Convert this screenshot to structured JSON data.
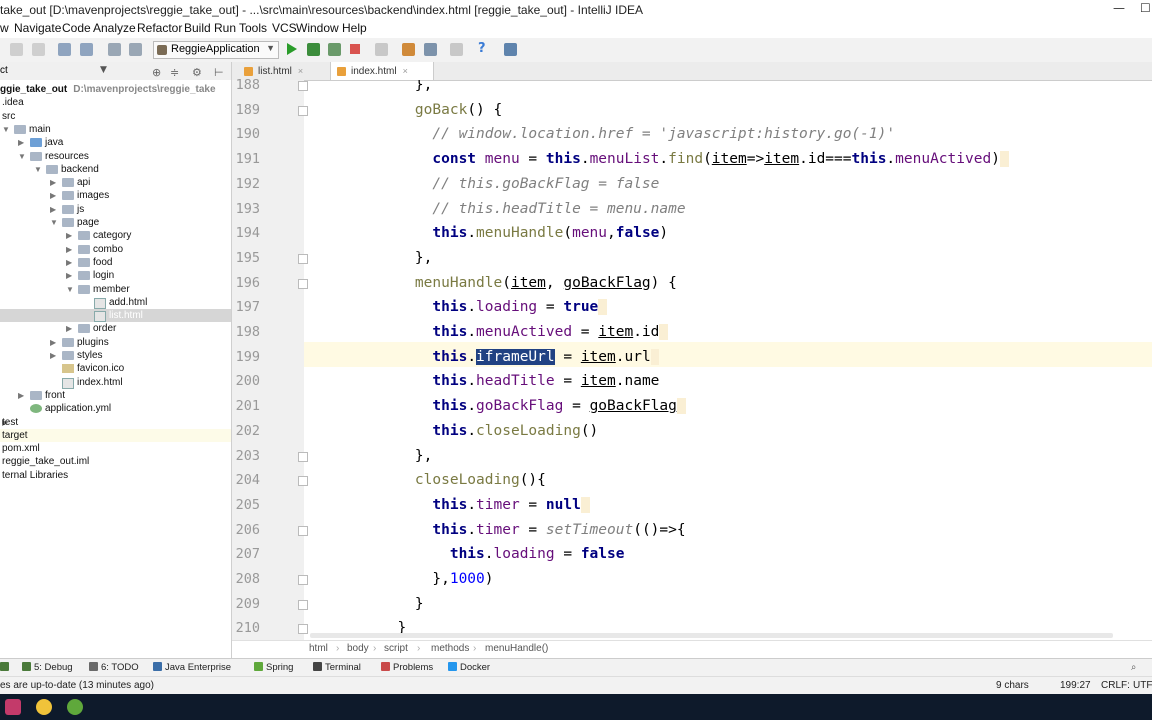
{
  "window": {
    "title": "take_out [D:\\mavenprojects\\reggie_take_out] - ...\\src\\main\\resources\\backend\\index.html [reggie_take_out] - IntelliJ IDEA",
    "minimize_glyph": "—",
    "maximize_glyph": "☐"
  },
  "menu": [
    "w",
    "Navigate",
    "Code",
    "Analyze",
    "Refactor",
    "Build",
    "Run",
    "Tools",
    "VCS",
    "Window",
    "Help"
  ],
  "toolbar": {
    "run_config": "ReggieApplication",
    "help_glyph": "?"
  },
  "project": {
    "header": "ct",
    "tree": [
      {
        "label": "ggie_take_out",
        "path": "D:\\mavenprojects\\reggie_take",
        "bold": true,
        "icon": "none"
      },
      {
        "label": ".idea",
        "icon": "none"
      },
      {
        "label": "src",
        "icon": "none"
      },
      {
        "label": "main",
        "icon": "folder"
      },
      {
        "label": "java",
        "icon": "srcf"
      },
      {
        "label": "resources",
        "icon": "folder"
      },
      {
        "label": "backend",
        "icon": "folder"
      },
      {
        "label": "api",
        "icon": "folder"
      },
      {
        "label": "images",
        "icon": "folder"
      },
      {
        "label": "js",
        "icon": "folder"
      },
      {
        "label": "page",
        "icon": "folder"
      },
      {
        "label": "category",
        "icon": "folder"
      },
      {
        "label": "combo",
        "icon": "folder"
      },
      {
        "label": "food",
        "icon": "folder"
      },
      {
        "label": "login",
        "icon": "folder"
      },
      {
        "label": "member",
        "icon": "folder"
      },
      {
        "label": "add.html",
        "icon": "html"
      },
      {
        "label": "list.html",
        "icon": "html",
        "selected": true
      },
      {
        "label": "order",
        "icon": "folder"
      },
      {
        "label": "plugins",
        "icon": "folder"
      },
      {
        "label": "styles",
        "icon": "folder"
      },
      {
        "label": "favicon.ico",
        "icon": "ico"
      },
      {
        "label": "index.html",
        "icon": "html"
      },
      {
        "label": "front",
        "icon": "folder"
      },
      {
        "label": "application.yml",
        "icon": "yml"
      },
      {
        "label": "test",
        "icon": "none"
      },
      {
        "label": "target",
        "icon": "none",
        "highlight": true
      },
      {
        "label": "pom.xml",
        "icon": "none"
      },
      {
        "label": "reggie_take_out.iml",
        "icon": "none"
      },
      {
        "label": "ternal Libraries",
        "icon": "none"
      }
    ]
  },
  "tabs": [
    {
      "label": "list.html",
      "close": "×"
    },
    {
      "label": "index.html",
      "close": "×",
      "active": true
    }
  ],
  "code": {
    "lines": [
      {
        "n": "188",
        "segs": [
          {
            "t": "    },"
          }
        ]
      },
      {
        "n": "189",
        "segs": [
          {
            "t": "    "
          },
          {
            "t": "goBack",
            "c": "fn"
          },
          {
            "t": "() {"
          }
        ]
      },
      {
        "n": "190",
        "segs": [
          {
            "t": "      "
          },
          {
            "t": "// window.location.href = 'javascript:history.go(-1)'",
            "c": "cm"
          }
        ]
      },
      {
        "n": "191",
        "segs": [
          {
            "t": "      "
          },
          {
            "t": "const",
            "c": "kw"
          },
          {
            "t": " "
          },
          {
            "t": "menu",
            "c": "pr"
          },
          {
            "t": " = "
          },
          {
            "t": "this",
            "c": "kw"
          },
          {
            "t": "."
          },
          {
            "t": "menuList",
            "c": "pr"
          },
          {
            "t": "."
          },
          {
            "t": "find",
            "c": "fn"
          },
          {
            "t": "("
          },
          {
            "t": "item",
            "c": "ul"
          },
          {
            "t": "=>"
          },
          {
            "t": "item",
            "c": "ul"
          },
          {
            "t": ".id==="
          },
          {
            "t": "this",
            "c": "kw"
          },
          {
            "t": "."
          },
          {
            "t": "menuActived",
            "c": "pr"
          },
          {
            "t": ")"
          },
          {
            "t": " ",
            "c": "hint"
          }
        ]
      },
      {
        "n": "192",
        "segs": [
          {
            "t": "      "
          },
          {
            "t": "// this.goBackFlag = false",
            "c": "cm"
          }
        ]
      },
      {
        "n": "193",
        "segs": [
          {
            "t": "      "
          },
          {
            "t": "// this.headTitle = menu.name",
            "c": "cm"
          }
        ]
      },
      {
        "n": "194",
        "segs": [
          {
            "t": "      "
          },
          {
            "t": "this",
            "c": "kw"
          },
          {
            "t": "."
          },
          {
            "t": "menuHandle",
            "c": "fn"
          },
          {
            "t": "("
          },
          {
            "t": "menu",
            "c": "pr"
          },
          {
            "t": ","
          },
          {
            "t": "false",
            "c": "kw"
          },
          {
            "t": ")"
          }
        ]
      },
      {
        "n": "195",
        "segs": [
          {
            "t": "    },"
          }
        ]
      },
      {
        "n": "196",
        "segs": [
          {
            "t": "    "
          },
          {
            "t": "menuHandle",
            "c": "fn"
          },
          {
            "t": "("
          },
          {
            "t": "item",
            "c": "ul"
          },
          {
            "t": ", "
          },
          {
            "t": "goBackFlag",
            "c": "ul"
          },
          {
            "t": ") {"
          }
        ]
      },
      {
        "n": "197",
        "segs": [
          {
            "t": "      "
          },
          {
            "t": "this",
            "c": "kw"
          },
          {
            "t": "."
          },
          {
            "t": "loading",
            "c": "pr"
          },
          {
            "t": " = "
          },
          {
            "t": "true",
            "c": "kw"
          },
          {
            "t": " ",
            "c": "hint"
          }
        ]
      },
      {
        "n": "198",
        "segs": [
          {
            "t": "      "
          },
          {
            "t": "this",
            "c": "kw"
          },
          {
            "t": "."
          },
          {
            "t": "menuActived",
            "c": "pr"
          },
          {
            "t": " = "
          },
          {
            "t": "item",
            "c": "ul"
          },
          {
            "t": ".id"
          },
          {
            "t": " ",
            "c": "hint"
          }
        ]
      },
      {
        "n": "199",
        "segs": [
          {
            "t": "      "
          },
          {
            "t": "this",
            "c": "kw"
          },
          {
            "t": "."
          },
          {
            "t": "iframeUrl",
            "c": "sel"
          },
          {
            "t": " = "
          },
          {
            "t": "item",
            "c": "ul"
          },
          {
            "t": ".url"
          },
          {
            "t": " ",
            "c": "hint"
          }
        ]
      },
      {
        "n": "200",
        "segs": [
          {
            "t": "      "
          },
          {
            "t": "this",
            "c": "kw"
          },
          {
            "t": "."
          },
          {
            "t": "headTitle",
            "c": "pr"
          },
          {
            "t": " = "
          },
          {
            "t": "item",
            "c": "ul"
          },
          {
            "t": ".name"
          }
        ]
      },
      {
        "n": "201",
        "segs": [
          {
            "t": "      "
          },
          {
            "t": "this",
            "c": "kw"
          },
          {
            "t": "."
          },
          {
            "t": "goBackFlag",
            "c": "pr"
          },
          {
            "t": " = "
          },
          {
            "t": "goBackFlag",
            "c": "ul"
          },
          {
            "t": " ",
            "c": "hint"
          }
        ]
      },
      {
        "n": "202",
        "segs": [
          {
            "t": "      "
          },
          {
            "t": "this",
            "c": "kw"
          },
          {
            "t": "."
          },
          {
            "t": "closeLoading",
            "c": "fn"
          },
          {
            "t": "()"
          }
        ]
      },
      {
        "n": "203",
        "segs": [
          {
            "t": "    },"
          }
        ]
      },
      {
        "n": "204",
        "segs": [
          {
            "t": "    "
          },
          {
            "t": "closeLoading",
            "c": "fn"
          },
          {
            "t": "(){"
          }
        ]
      },
      {
        "n": "205",
        "segs": [
          {
            "t": "      "
          },
          {
            "t": "this",
            "c": "kw"
          },
          {
            "t": "."
          },
          {
            "t": "timer",
            "c": "pr"
          },
          {
            "t": " = "
          },
          {
            "t": "null",
            "c": "kw"
          },
          {
            "t": " ",
            "c": "hint"
          }
        ]
      },
      {
        "n": "206",
        "segs": [
          {
            "t": "      "
          },
          {
            "t": "this",
            "c": "kw"
          },
          {
            "t": "."
          },
          {
            "t": "timer",
            "c": "pr"
          },
          {
            "t": " = "
          },
          {
            "t": "setTimeout",
            "c": "cm"
          },
          {
            "t": "(()=>{"
          }
        ]
      },
      {
        "n": "207",
        "segs": [
          {
            "t": "        "
          },
          {
            "t": "this",
            "c": "kw"
          },
          {
            "t": "."
          },
          {
            "t": "loading",
            "c": "pr"
          },
          {
            "t": " = "
          },
          {
            "t": "false",
            "c": "kw"
          }
        ]
      },
      {
        "n": "208",
        "segs": [
          {
            "t": "      },"
          },
          {
            "t": "1000",
            "c": "nm"
          },
          {
            "t": ")"
          }
        ]
      },
      {
        "n": "209",
        "segs": [
          {
            "t": "    }"
          }
        ]
      },
      {
        "n": "210",
        "segs": [
          {
            "t": "  }"
          }
        ]
      }
    ]
  },
  "breadcrumb": [
    "html",
    "body",
    "script",
    "methods",
    "menuHandle()"
  ],
  "tool_windows": [
    {
      "label": "5: Debug",
      "color": "#4a7a3a"
    },
    {
      "label": "6: TODO",
      "color": "#6a6a6a"
    },
    {
      "label": "Java Enterprise",
      "color": "#3b6ea8"
    },
    {
      "label": "Spring",
      "color": "#5fa83b"
    },
    {
      "label": "Terminal",
      "color": "#444444"
    },
    {
      "label": "Problems",
      "color": "#c94a4a"
    },
    {
      "label": "Docker",
      "color": "#2496ed"
    }
  ],
  "status": {
    "message": "es are up-to-date (13 minutes ago)",
    "chars": "9 chars",
    "position": "199:27",
    "line_sep": "CRLF:",
    "encoding": "UTF"
  },
  "colors": {
    "selection": "#214283",
    "current_line": "#fffae3",
    "keyword": "#000080",
    "comment": "#808080"
  }
}
